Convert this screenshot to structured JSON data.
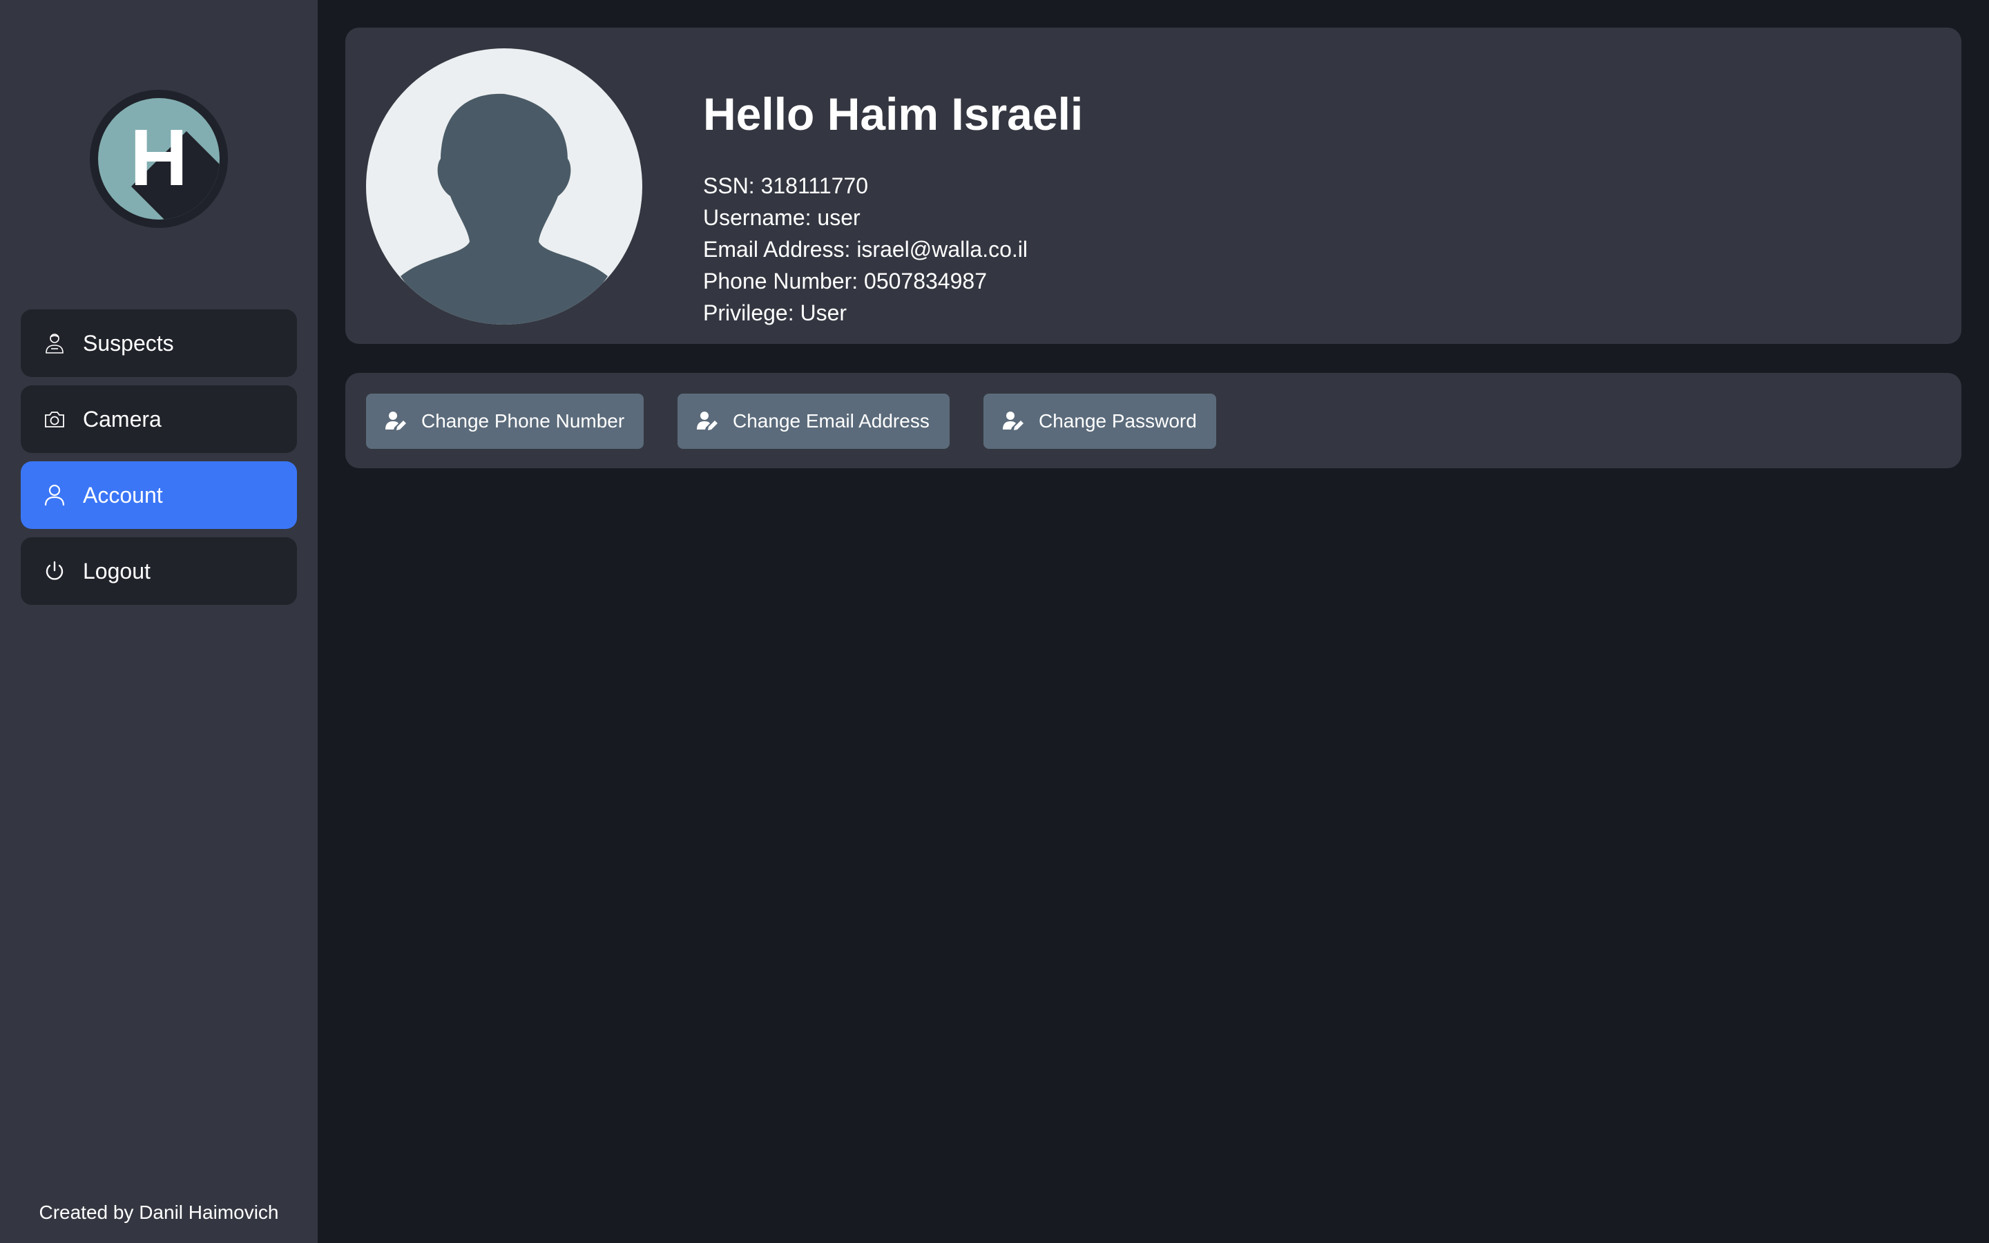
{
  "sidebar": {
    "logo": {
      "letter": "H",
      "icon": "h-logo-icon"
    },
    "items": [
      {
        "label": "Suspects",
        "icon": "suspect-icon",
        "active": false
      },
      {
        "label": "Camera",
        "icon": "camera-icon",
        "active": false
      },
      {
        "label": "Account",
        "icon": "user-icon",
        "active": true
      },
      {
        "label": "Logout",
        "icon": "power-icon",
        "active": false
      }
    ],
    "footer": "Created by Danil Haimovich"
  },
  "profile": {
    "greeting": "Hello Haim Israeli",
    "ssn": "SSN: 318111770",
    "username": "Username: user",
    "email": "Email Address: israel@walla.co.il",
    "phone": "Phone Number: 0507834987",
    "privilege": "Privilege: User",
    "avatar_icon": "default-avatar-icon"
  },
  "actions": {
    "change_phone": "Change Phone Number",
    "change_email": "Change Email Address",
    "change_password": "Change Password",
    "icon": "user-edit-icon"
  },
  "colors": {
    "sidebar_bg": "#343741",
    "page_bg": "#181a22",
    "nav_item_bg": "#21232b",
    "accent": "#3b76f6",
    "card_bg": "#343741",
    "button_bg": "#5b6b7b",
    "logo_teal": "#82aeb1"
  }
}
